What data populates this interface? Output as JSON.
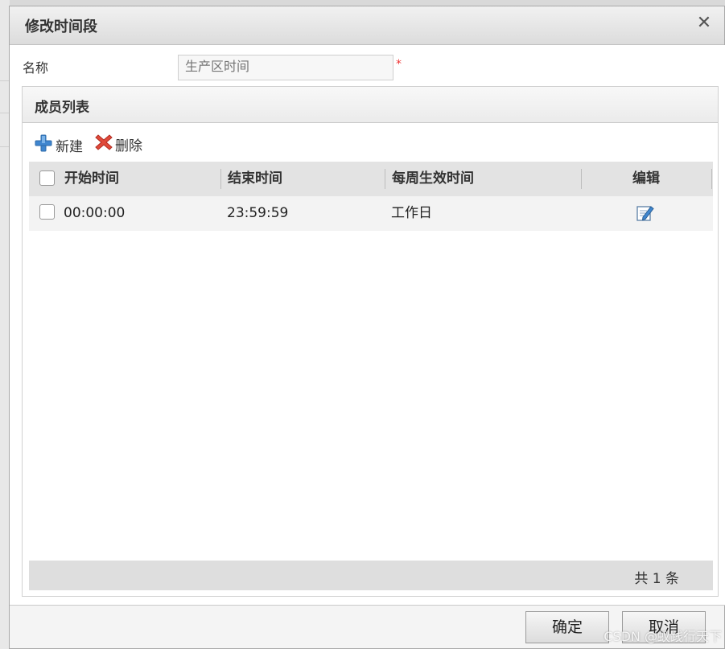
{
  "dialog": {
    "title": "修改时间段",
    "close_icon": "close-icon"
  },
  "form": {
    "name_label": "名称",
    "name_placeholder": "生产区时间",
    "required_mark": "*"
  },
  "panel": {
    "title": "成员列表"
  },
  "toolbar": {
    "new_label": "新建",
    "delete_label": "删除"
  },
  "grid": {
    "columns": [
      "开始时间",
      "结束时间",
      "每周生效时间",
      "编辑"
    ],
    "rows": [
      {
        "start": "00:00:00",
        "end": "23:59:59",
        "weekly": "工作日",
        "edit_icon": "edit-icon"
      }
    ],
    "count_text": "共 1 条"
  },
  "buttons": {
    "ok": "确定",
    "cancel": "取消"
  },
  "watermark": "CSDN @蚁践行天下",
  "colors": {
    "required": "#e33333",
    "header_bg": "#e3e3e3"
  }
}
